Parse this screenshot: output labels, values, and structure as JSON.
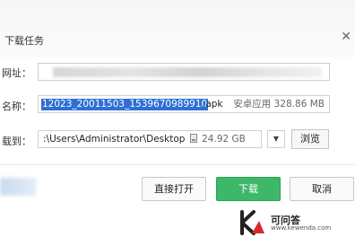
{
  "dialog": {
    "title": "下载任务",
    "close_symbol": "✕"
  },
  "url_row": {
    "label": "网址："
  },
  "name_row": {
    "label": "名称：",
    "filename_selected": "12023_20011503_1539670989910",
    "extension": ".apk",
    "file_type": "安卓应用",
    "file_size": "328.86 MB"
  },
  "save_row": {
    "label": "载到：",
    "path": ":\\Users\\Administrator\\Desktop",
    "free_space": "24.92 GB",
    "dropdown_symbol": "▼",
    "browse_label": "浏览"
  },
  "buttons": {
    "open_label": "直接打开",
    "download_label": "下载",
    "cancel_label": "取消"
  },
  "watermark": {
    "name": "可问答",
    "url": "www.kewenda.com"
  },
  "colors": {
    "selection": "#2f6fd6",
    "download_button": "#3cb868",
    "watermark_logo": "#d6292b"
  }
}
